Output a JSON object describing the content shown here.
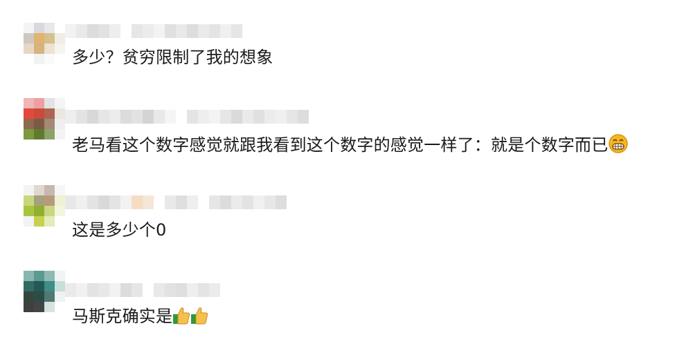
{
  "comments": [
    {
      "avatar_colors": [
        "#f4f4f4",
        "#d9d9dd",
        "#e8e8ea",
        "#ffffff",
        "#cfc8c0",
        "#e2b36c",
        "#d7c08a",
        "#f0ede6",
        "#e7d8c4",
        "#d8b37c",
        "#efe2cf",
        "#f7f3ee",
        "#ffffff",
        "#f2f2f2",
        "#fafafa",
        "#ffffff"
      ],
      "name_colors": [
        "#f2f2f2",
        "#e9e9e9",
        "#dcdcdc",
        "#e2e2e2",
        "#eeeeee",
        "#ffffff",
        "#e6e6e6",
        "#ececec",
        "#f3f3f3",
        "#e0e0e0",
        "#e9e9e9",
        "#dddddd",
        "#eaeaea",
        "#e4e4e4",
        "#f0f0f0",
        "#e6e6e6"
      ],
      "text": "多少？贫穷限制了我的想象",
      "emoji": []
    },
    {
      "avatar_colors": [
        "#f2b4b6",
        "#f09ea0",
        "#e3e3e3",
        "#f5f5f5",
        "#e8463c",
        "#cf4a3a",
        "#b06452",
        "#ece6e0",
        "#8f6a4b",
        "#7e5a43",
        "#a38a74",
        "#efefef",
        "#7a9a3a",
        "#5f7c2c",
        "#8da166",
        "#f4f4f4"
      ],
      "name_colors": [
        "#eeeeee",
        "#e3e3e3",
        "#d8d8d8",
        "#e6e6e6",
        "#ececec",
        "#dcdcdc",
        "#e2e2e2",
        "#d4d4d4",
        "#e8e8e8",
        "#f5f5f5",
        "#ffffff",
        "#e4e4e4",
        "#eeeeee",
        "#f3f3f3",
        "#e6e6e6",
        "#dadada",
        "#eaeaea",
        "#e0e0e0",
        "#ececec",
        "#f0f0f0",
        "#e6e6e6",
        "#dddddd"
      ],
      "text": "老马看这个数字感觉就跟我看到这个数字的感觉一样了：就是个数字而已",
      "emoji": [
        "grin"
      ]
    },
    {
      "avatar_colors": [
        "#f4f4f4",
        "#e3d6d0",
        "#c9b7ae",
        "#f6f6f6",
        "#c9d67a",
        "#a7a07a",
        "#b89a7c",
        "#eef2d0",
        "#a8c63a",
        "#8fb12c",
        "#cbd67e",
        "#f2f6df",
        "#f3f3f3",
        "#c6d24a",
        "#e5ebb8",
        "#ffffff"
      ],
      "name_colors": [
        "#e8e8e8",
        "#f0f0f0",
        "#e3e3e3",
        "#d9d9d9",
        "#e4e4e4",
        "#f2f2f2",
        "#f7dcc4",
        "#f5e6d8",
        "#ffffff",
        "#e9e9e9",
        "#dedede",
        "#eeeeee",
        "#ffffff",
        "#e6e6e6",
        "#dcdcdc",
        "#ebebeb",
        "#e3e3e3",
        "#f0f0f0",
        "#e7e7e7",
        "#dddddd"
      ],
      "text": "这是多少个0",
      "emoji": []
    },
    {
      "avatar_colors": [
        "#88b7b0",
        "#5a9a93",
        "#8eb9b4",
        "#eef5f4",
        "#2f6c64",
        "#1f5b54",
        "#3a8f86",
        "#c5dfdb",
        "#34463f",
        "#2a4d45",
        "#4d7a72",
        "#eef2f1",
        "#3f3f3f",
        "#454545",
        "#d6e3e1",
        "#ffffff"
      ],
      "name_colors": [
        "#eaeaea",
        "#f1f1f1",
        "#e3e3e3",
        "#e8e8e8",
        "#f2f2f2",
        "#dcdcdc",
        "#e6e6e6",
        "#ffffff",
        "#e9e9e9",
        "#e2e2e2",
        "#dedede",
        "#eeeeee",
        "#e4e4e4",
        "#ebebeb"
      ],
      "text": "马斯克确实是",
      "emoji": [
        "thumbs-up",
        "thumbs-up"
      ]
    }
  ]
}
